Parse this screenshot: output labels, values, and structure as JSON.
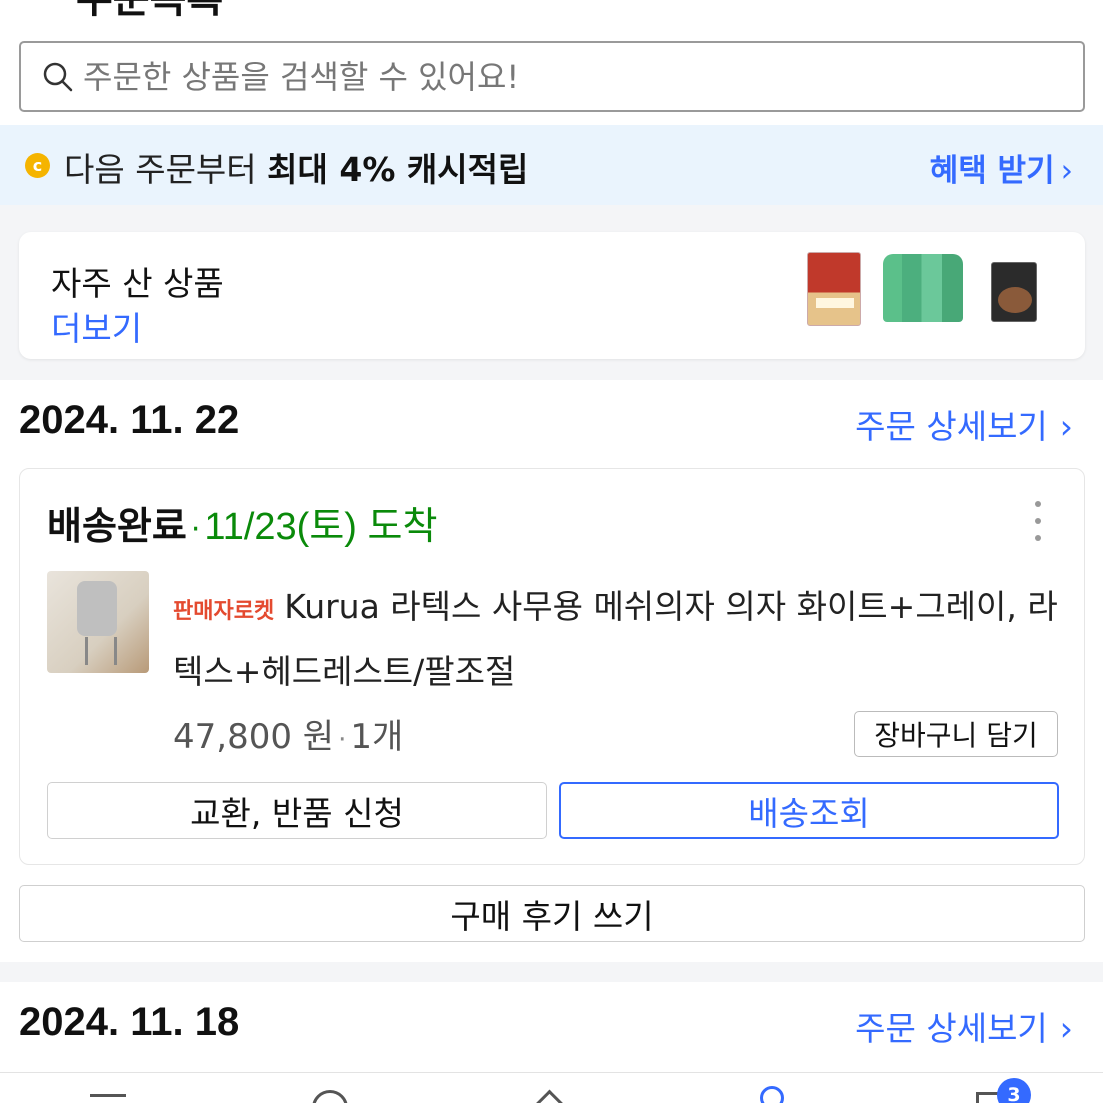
{
  "header": {
    "back_icon": "chevron-left-icon",
    "title": "주문목록"
  },
  "search": {
    "placeholder": "주문한 상품을 검색할 수 있어요!",
    "icon": "search-icon"
  },
  "promo": {
    "coin_symbol": "c",
    "text_prefix": "다음 주문부터",
    "text_bold": "최대 4% 캐시적립",
    "benefit_label": "혜택 받기",
    "accent_color": "#346aff"
  },
  "frequent": {
    "label": "자주 산 상품",
    "more_label": "더보기"
  },
  "orders": [
    {
      "date": "2024. 11. 22",
      "detail_label": "주문 상세보기",
      "status": "배송완료",
      "arrival": "11/23(토) 도착",
      "badge": "판매자로켓",
      "product_name": "Kurua 라텍스 사무용 메쉬의자 의자 화이트+그레이, 라텍스+헤드레스트/팔조절",
      "price": "47,800 원",
      "quantity": "1개",
      "cart_button": "장바구니 담기",
      "exchange_button": "교환, 반품 신청",
      "track_button": "배송조회",
      "review_button": "구매 후기 쓰기"
    },
    {
      "date": "2024. 11. 18",
      "detail_label": "주문 상세보기"
    }
  ],
  "bottom_nav": {
    "cart_badge": "3"
  }
}
